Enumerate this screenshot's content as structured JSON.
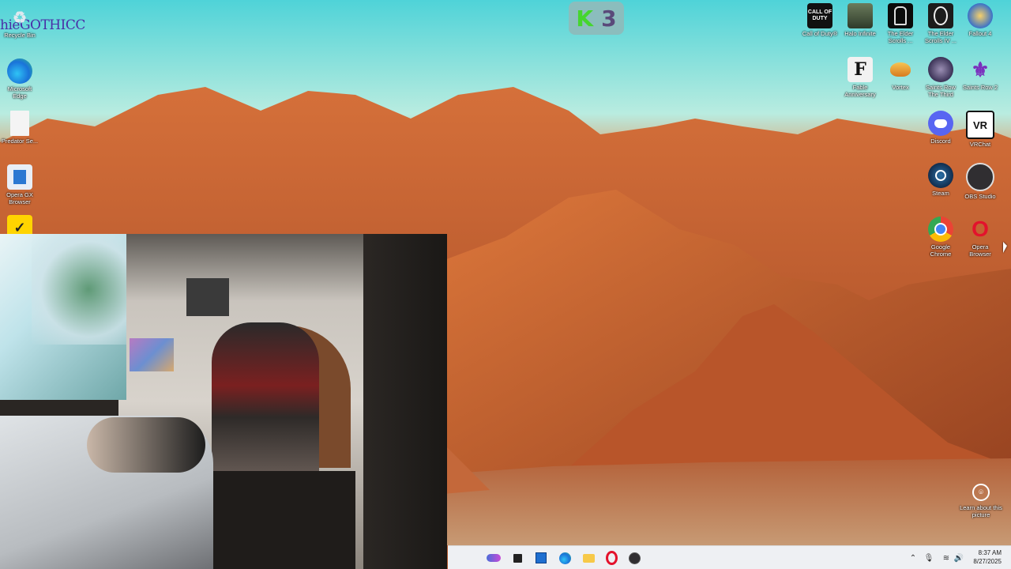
{
  "desktop": {
    "brand_text": "hieGOTHICC",
    "k3_logo": {
      "k": "K",
      "n": "3"
    },
    "left_icons": [
      {
        "label": "Recycle Bin",
        "icon": "recycle-bin-icon"
      },
      {
        "label": "Microsoft Edge",
        "icon": "edge-icon"
      },
      {
        "label": "Predator Se...",
        "icon": "file-icon"
      },
      {
        "label": "Opera GX Browser",
        "icon": "opera-gx-icon"
      },
      {
        "label": "",
        "icon": "norton-check-icon"
      }
    ],
    "right_icons": [
      {
        "label": "Call of Duty®",
        "icon": "call-of-duty-icon",
        "glyph": "CALL OF DUTY"
      },
      {
        "label": "Halo Infinite",
        "icon": "halo-infinite-icon",
        "glyph": ""
      },
      {
        "label": "The Elder Scrolls ...",
        "icon": "elder-scrolls-icon",
        "glyph": ""
      },
      {
        "label": "The Elder Scrolls IV ...",
        "icon": "oblivion-icon",
        "glyph": ""
      },
      {
        "label": "Fallout 4",
        "icon": "fallout-4-icon",
        "glyph": ""
      },
      {
        "label": "Fable Anniversary",
        "icon": "fable-anniversary-icon",
        "glyph": "F"
      },
      {
        "label": "Vortex",
        "icon": "vortex-icon",
        "glyph": ""
      },
      {
        "label": "Saints Row The Third",
        "icon": "saints-row-third-icon",
        "glyph": ""
      },
      {
        "label": "Saints Row 2",
        "icon": "saints-row-2-icon",
        "glyph": "⚜"
      },
      {
        "label": "Discord",
        "icon": "discord-icon",
        "glyph": ""
      },
      {
        "label": "VRChat",
        "icon": "vrchat-icon",
        "glyph": "VR"
      },
      {
        "label": "Steam",
        "icon": "steam-icon",
        "glyph": ""
      },
      {
        "label": "OBS Studio",
        "icon": "obs-studio-icon",
        "glyph": ""
      },
      {
        "label": "Google Chrome",
        "icon": "google-chrome-icon",
        "glyph": ""
      },
      {
        "label": "Opera Browser",
        "icon": "opera-browser-icon",
        "glyph": "O"
      }
    ],
    "learn_about": {
      "label": "Learn about this picture",
      "icon": "camera-icon"
    }
  },
  "taskbar": {
    "pinned": [
      {
        "name": "ai-chat-icon"
      },
      {
        "name": "task-view-icon"
      },
      {
        "name": "microsoft-store-icon"
      },
      {
        "name": "edge-icon"
      },
      {
        "name": "file-explorer-icon"
      },
      {
        "name": "opera-icon"
      },
      {
        "name": "obs-icon"
      }
    ],
    "tray": [
      {
        "name": "chevron-up-icon",
        "glyph": "⌃"
      },
      {
        "name": "microphone-icon",
        "glyph": "🎙"
      },
      {
        "name": "wifi-icon",
        "glyph": "≋"
      },
      {
        "name": "speaker-icon",
        "glyph": "🔊"
      }
    ],
    "time": "8:37 AM",
    "date": "8/27/2025"
  },
  "colors": {
    "sky": "#4fd3d8",
    "rock": "#b5532a",
    "taskbar": "#eef0f3"
  }
}
